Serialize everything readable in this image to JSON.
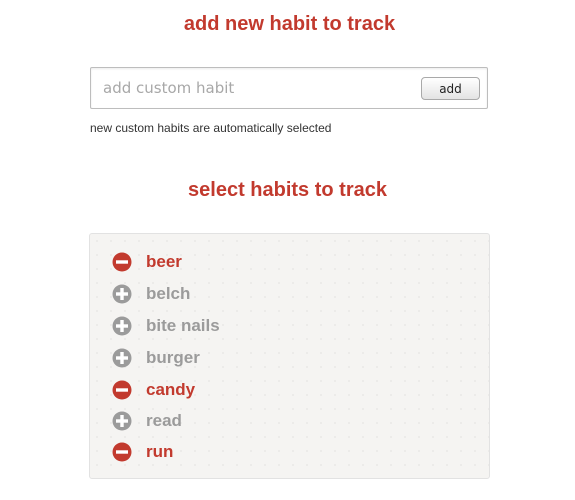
{
  "add_section": {
    "title": "add new habit to track",
    "input_value": "",
    "input_placeholder": "add custom habit",
    "add_button_label": "add",
    "hint": "new custom habits are automatically selected"
  },
  "select_section": {
    "title": "select habits to track",
    "habits": [
      {
        "label": "beer",
        "selected": true,
        "icon": "minus-circle-icon"
      },
      {
        "label": "belch",
        "selected": false,
        "icon": "plus-circle-icon"
      },
      {
        "label": "bite nails",
        "selected": false,
        "icon": "plus-circle-icon"
      },
      {
        "label": "burger",
        "selected": false,
        "icon": "plus-circle-icon"
      },
      {
        "label": "candy",
        "selected": true,
        "icon": "minus-circle-icon"
      },
      {
        "label": "read",
        "selected": false,
        "icon": "plus-circle-icon"
      },
      {
        "label": "run",
        "selected": true,
        "icon": "minus-circle-icon"
      }
    ]
  },
  "colors": {
    "accent": "#c23a2e",
    "inactive": "#9b9b9b",
    "panel_background": "#f5f4f2"
  }
}
